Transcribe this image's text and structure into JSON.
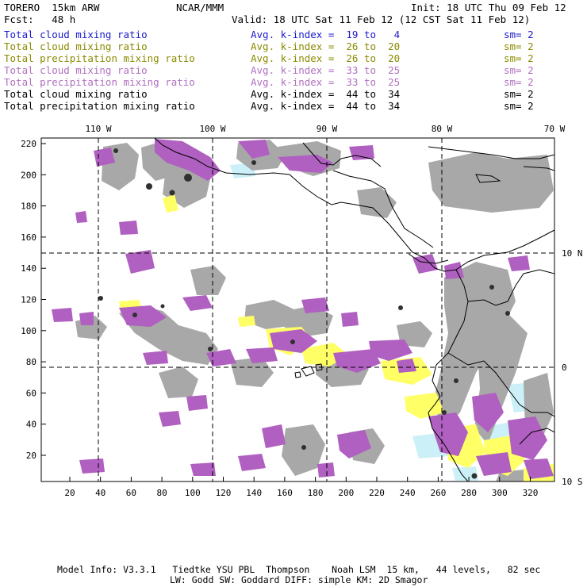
{
  "header": {
    "model": "TORERO  15km ARW",
    "org": "NCAR/MMM",
    "init": "Init: 18 UTC Thu 09 Feb 12",
    "fcst": "Fcst:   48 h",
    "valid": "Valid: 18 UTC Sat 11 Feb 12 (12 CST Sat 11 Feb 12)"
  },
  "legend": [
    {
      "field": "Total cloud mixing ratio",
      "kindex": "Avg. k-index =  19 to   4",
      "sm": "sm= 2",
      "color": "#1a1acc"
    },
    {
      "field": "Total cloud mixing ratio",
      "kindex": "Avg. k-index =  26 to  20",
      "sm": "sm= 2",
      "color": "#8a8a00"
    },
    {
      "field": "Total precipitation mixing ratio",
      "kindex": "Avg. k-index =  26 to  20",
      "sm": "sm= 2",
      "color": "#8a8a00"
    },
    {
      "field": "Total cloud mixing ratio",
      "kindex": "Avg. k-index =  33 to  25",
      "sm": "sm= 2",
      "color": "#b070c0"
    },
    {
      "field": "Total precipitation mixing ratio",
      "kindex": "Avg. k-index =  33 to  25",
      "sm": "sm= 2",
      "color": "#b070c0"
    },
    {
      "field": "Total cloud mixing ratio",
      "kindex": "Avg. k-index =  44 to  34",
      "sm": "sm= 2",
      "color": "#000000"
    },
    {
      "field": "Total precipitation mixing ratio",
      "kindex": "Avg. k-index =  44 to  34",
      "sm": "sm= 2",
      "color": "#000000"
    }
  ],
  "axes": {
    "top_labels": [
      "110 W",
      "100 W",
      "90 W",
      "80 W",
      "70 W"
    ],
    "right_labels": [
      "10 N",
      "0",
      "10 S"
    ],
    "left_ticks": [
      "220",
      "200",
      "180",
      "160",
      "140",
      "120",
      "100",
      "80",
      "60",
      "40",
      "20"
    ],
    "bottom_ticks": [
      "20",
      "40",
      "60",
      "80",
      "100",
      "120",
      "140",
      "160",
      "180",
      "200",
      "220",
      "240",
      "260",
      "280",
      "300",
      "320"
    ]
  },
  "colors": {
    "precip_purple": "#b060c0",
    "cloud_gray": "#a8a8a8",
    "dark_core": "#303030",
    "yellow": "#ffff66",
    "light_blue": "#ccf0f8",
    "coast": "#000000"
  },
  "footer": {
    "line1": "Model Info: V3.3.1   Tiedtke YSU PBL  Thompson    Noah LSM  15 km,   44 levels,   82 sec",
    "line2": "LW: Godd SW: Goddard DIFF: simple KM: 2D Smagor"
  }
}
